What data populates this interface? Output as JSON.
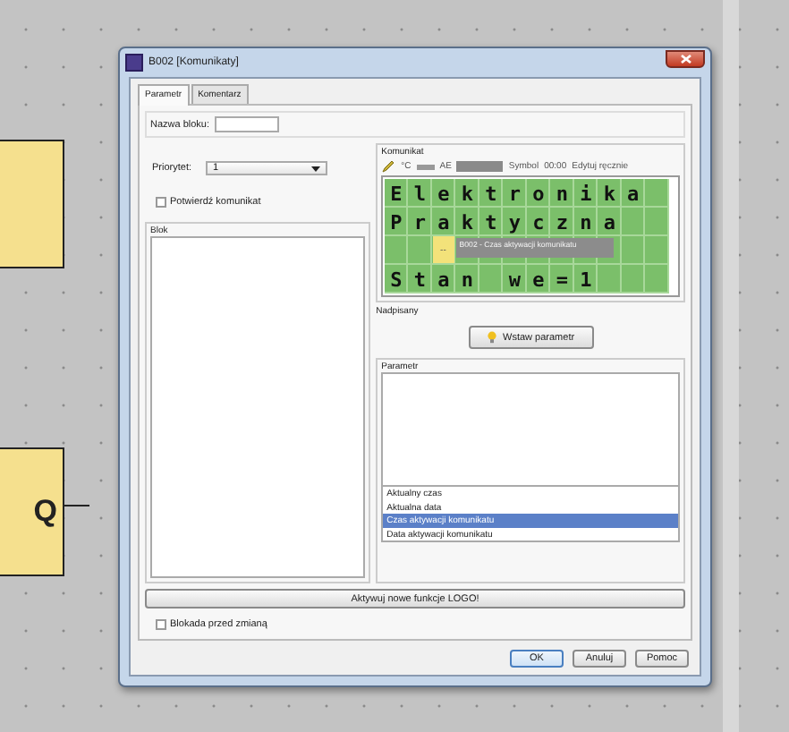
{
  "window": {
    "title": "B002 [Komunikaty]"
  },
  "tabs": [
    {
      "label": "Parametr",
      "selected": true
    },
    {
      "label": "Komentarz",
      "selected": false
    }
  ],
  "block_name": {
    "label": "Nazwa bloku:"
  },
  "priority": {
    "label": "Priorytet:",
    "value": "1"
  },
  "confirm_checkbox": {
    "label": "Potwierdź komunikat",
    "checked": false
  },
  "block_group": {
    "title": "Blok"
  },
  "message_group": {
    "title": "Komunikat",
    "toolbar": [
      "°C",
      "AE",
      "Symbol",
      "00:00",
      "Edytuj ręcznie"
    ],
    "lcd_rows": [
      "E l e k t r o n i k a",
      "P r a k t y c z n a",
      "",
      "S t a n   w e = 1"
    ],
    "marker": "--",
    "popup": "B002 - Czas aktywacji komunikatu",
    "overwritten_label": "Nadpisany",
    "insert_button": "Wstaw parametr"
  },
  "parameter_group": {
    "title": "Parametr",
    "items": [
      {
        "label": "Aktualny czas",
        "selected": false
      },
      {
        "label": "Aktualna data",
        "selected": false
      },
      {
        "label": "Czas aktywacji komunikatu",
        "selected": true
      },
      {
        "label": "Data aktywacji komunikatu",
        "selected": false
      }
    ]
  },
  "activate_button": "Aktywuj nowe funkcje LOGO!",
  "lock_checkbox": {
    "label": "Blokada przed zmianą",
    "checked": false
  },
  "buttons": [
    {
      "label": "OK",
      "kind": "default"
    },
    {
      "label": "Anuluj",
      "kind": "normal"
    },
    {
      "label": "Pomoc",
      "kind": "normal"
    }
  ],
  "canvas_blocks": [
    {
      "kind": "plain"
    },
    {
      "kind": "output",
      "pin": "Q"
    }
  ]
}
